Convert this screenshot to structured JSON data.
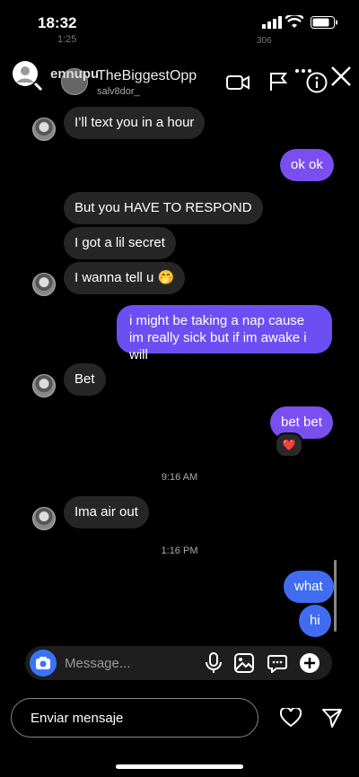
{
  "status_bar": {
    "time": "18:32",
    "ghost_time": "1:25",
    "ghost_right": "306"
  },
  "header": {
    "ghost_name": "ennupu",
    "display_name": "TheBiggestOpp",
    "username": "salv8dor_"
  },
  "messages": [
    {
      "side": "in",
      "text": "I’ll text you in a hour"
    },
    {
      "side": "out",
      "text": "ok ok"
    },
    {
      "side": "in",
      "text": "But you HAVE TO RESPOND"
    },
    {
      "side": "in",
      "text": "I got a lil secret"
    },
    {
      "side": "in",
      "text": "I wanna tell u 🤭"
    },
    {
      "side": "out",
      "text": "i might be taking a nap cause im really sick but if im awake i will"
    },
    {
      "side": "in",
      "text": "Bet"
    },
    {
      "side": "out",
      "text": "bet bet",
      "reaction": "❤️"
    },
    {
      "side": "in",
      "text": "Ima air out"
    },
    {
      "side": "out",
      "text": "what"
    },
    {
      "side": "out",
      "text": "hi"
    }
  ],
  "timestamps": [
    "9:16 AM",
    "1:16 PM"
  ],
  "composer": {
    "placeholder": "Message..."
  },
  "reply_bar": {
    "label": "Enviar mensaje"
  },
  "colors": {
    "outgoing_purple": "#7a4ff0",
    "outgoing_blue": "#3f6cf0",
    "incoming": "#262626",
    "camera": "#3a74f6"
  }
}
